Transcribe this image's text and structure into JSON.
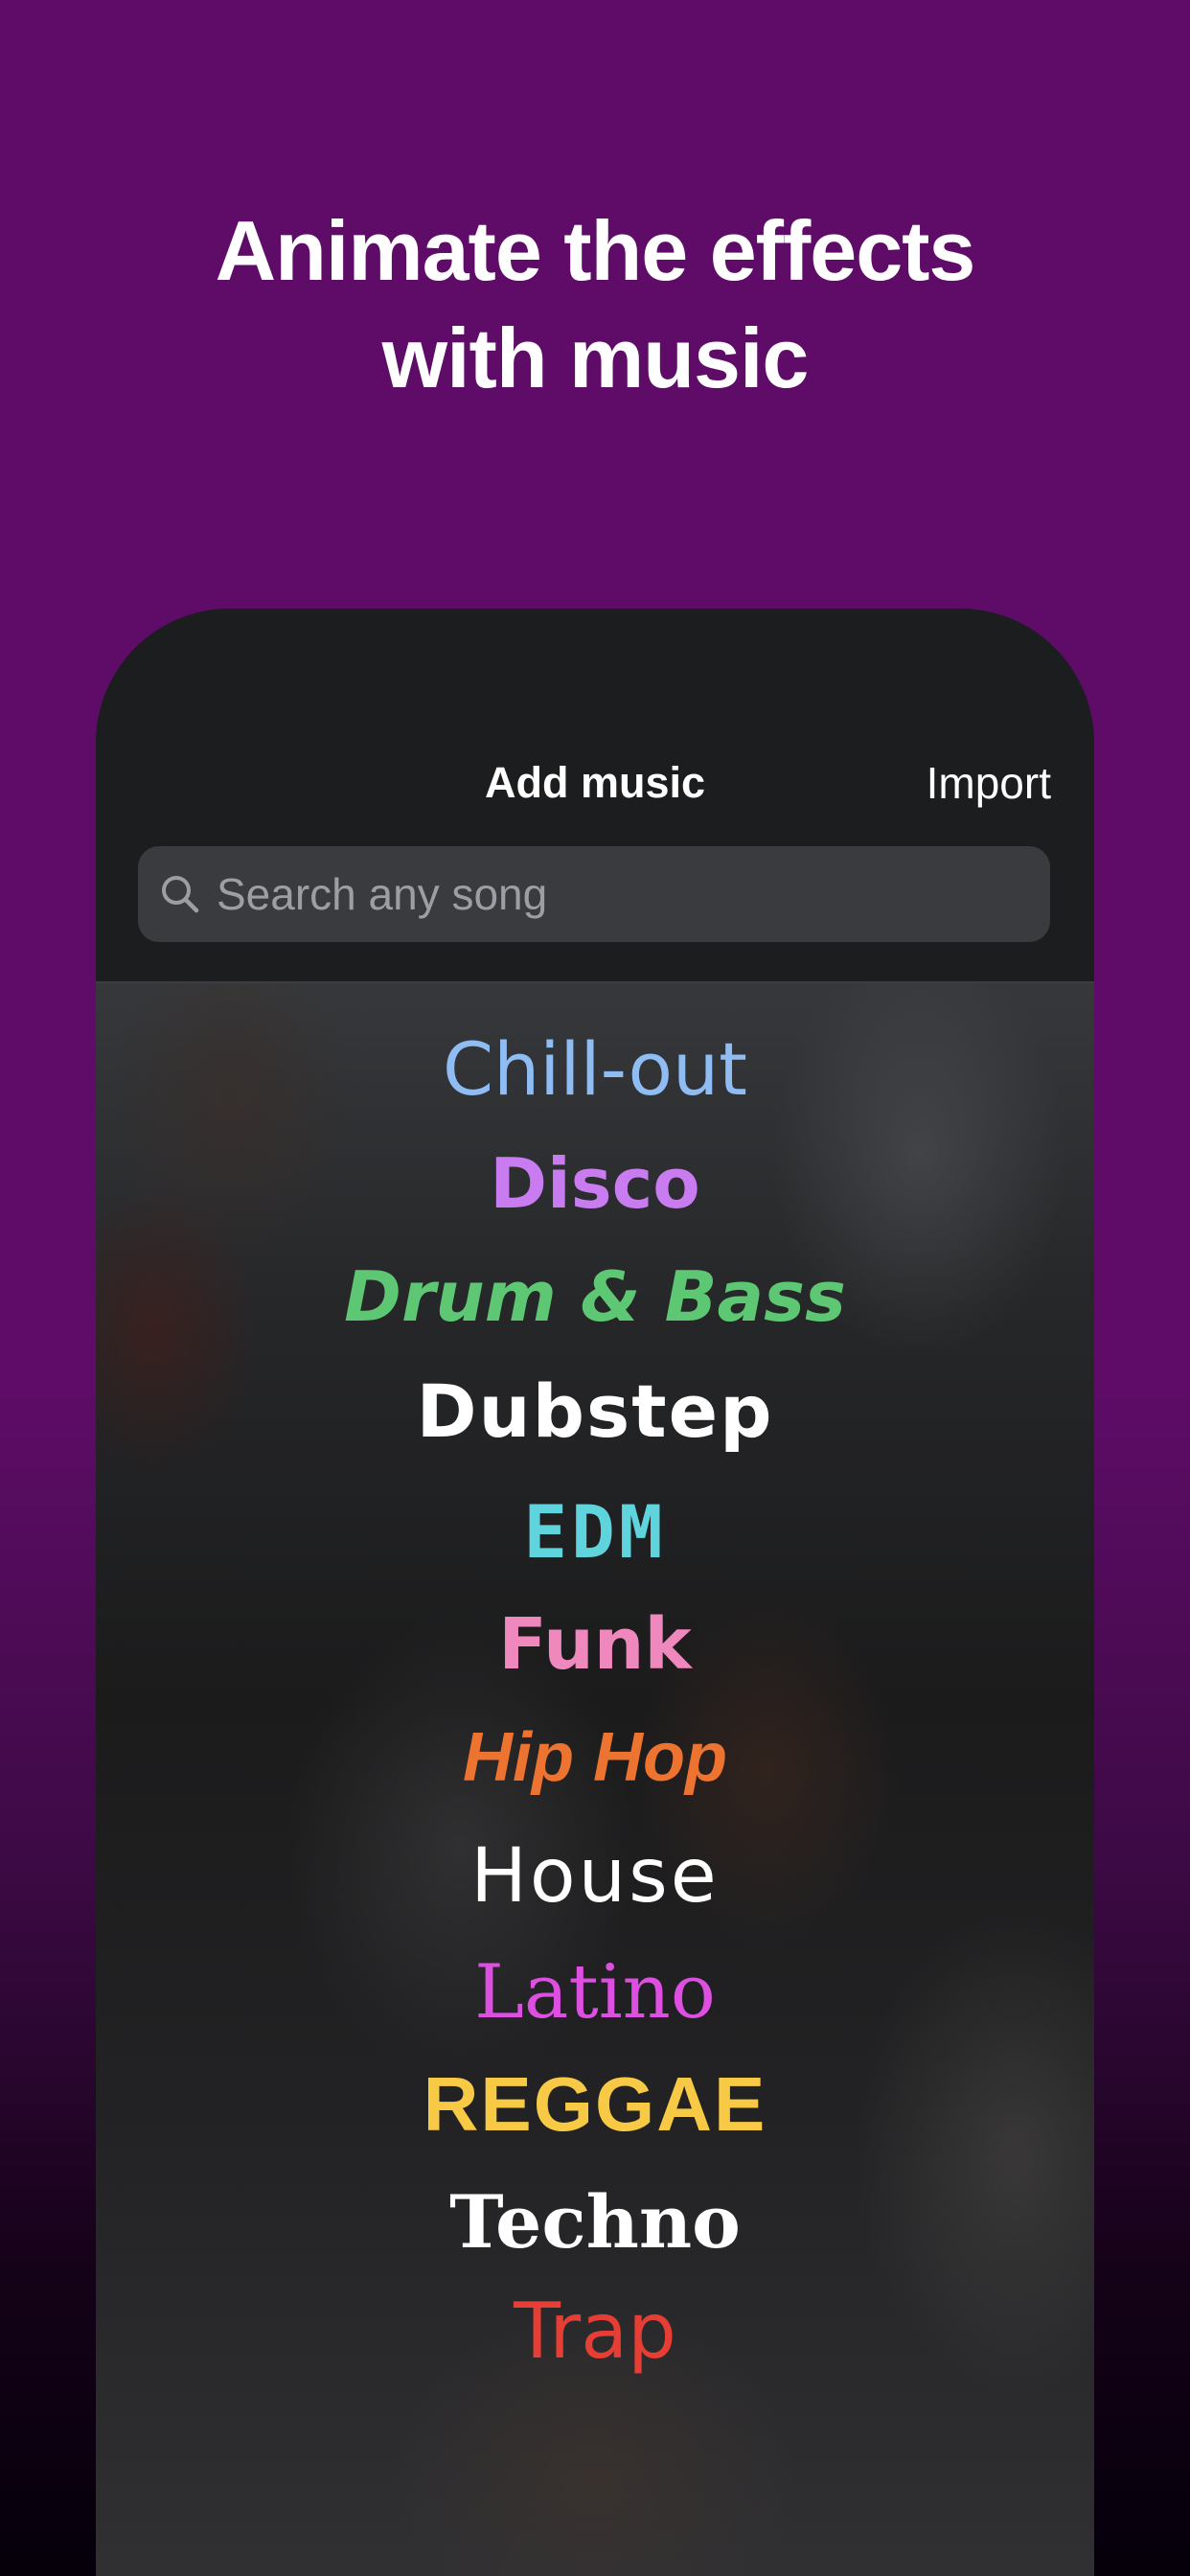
{
  "headline": {
    "line1": "Animate the effects",
    "line2": "with music"
  },
  "header": {
    "title": "Add music",
    "import_label": "Import"
  },
  "search": {
    "placeholder": "Search any song",
    "icon": "search-icon"
  },
  "genres": [
    {
      "label": "Chill-out",
      "color": "#8fbcf3"
    },
    {
      "label": "Disco",
      "color": "#c97cf0"
    },
    {
      "label": "Drum & Bass",
      "color": "#5ec774"
    },
    {
      "label": "Dubstep",
      "color": "#ffffff"
    },
    {
      "label": "EDM",
      "color": "#5fd4dd"
    },
    {
      "label": "Funk",
      "color": "#ef88bd"
    },
    {
      "label": "Hip Hop",
      "color": "#ec7330"
    },
    {
      "label": "House",
      "color": "#ffffff"
    },
    {
      "label": "Latino",
      "color": "#dd4fe0"
    },
    {
      "label": "REGGAE",
      "color": "#f7c945"
    },
    {
      "label": "Techno",
      "color": "#ffffff"
    },
    {
      "label": "Trap",
      "color": "#e63d34"
    }
  ],
  "colors": {
    "background": "#5e0c67",
    "phone_bg": "#1c1d1f",
    "search_bg": "#3a3b3e"
  }
}
